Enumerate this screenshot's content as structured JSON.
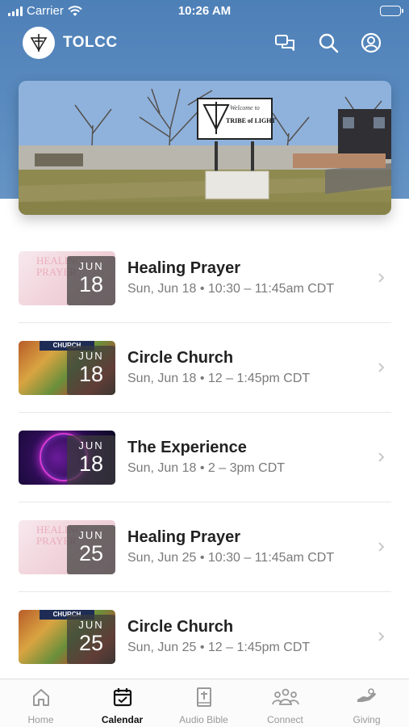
{
  "status_bar": {
    "carrier": "Carrier",
    "time": "10:26 AM"
  },
  "app": {
    "title": "TOLCC"
  },
  "header_icons": [
    "chat-bubbles-icon",
    "search-icon",
    "account-icon"
  ],
  "hero": {
    "sign_top": "Welcome to",
    "sign_main": "TRIBE of LIGHT"
  },
  "events": [
    {
      "title": "Healing Prayer",
      "month": "JUN",
      "day": "18",
      "subtitle": "Sun, Jun 18 • 10:30 – 11:45am CDT",
      "thumb_text": "HEALING PRAYER",
      "thumb_type": "healing"
    },
    {
      "title": "Circle Church",
      "month": "JUN",
      "day": "18",
      "subtitle": "Sun, Jun 18 • 12 – 1:45pm CDT",
      "thumb_text": "CHURCH",
      "thumb_type": "circle"
    },
    {
      "title": "The Experience",
      "month": "JUN",
      "day": "18",
      "subtitle": "Sun, Jun 18 • 2 – 3pm CDT",
      "thumb_text": "",
      "thumb_type": "experience"
    },
    {
      "title": "Healing Prayer",
      "month": "JUN",
      "day": "25",
      "subtitle": "Sun, Jun 25 • 10:30 – 11:45am CDT",
      "thumb_text": "HEALING PRAYER",
      "thumb_type": "healing"
    },
    {
      "title": "Circle Church",
      "month": "JUN",
      "day": "25",
      "subtitle": "Sun, Jun 25 • 12 – 1:45pm CDT",
      "thumb_text": "CHURCH",
      "thumb_type": "circle"
    }
  ],
  "tabs": [
    {
      "label": "Home",
      "icon": "home-icon",
      "active": false
    },
    {
      "label": "Calendar",
      "icon": "calendar-icon",
      "active": true
    },
    {
      "label": "Audio Bible",
      "icon": "bible-icon",
      "active": false
    },
    {
      "label": "Connect",
      "icon": "people-icon",
      "active": false
    },
    {
      "label": "Giving",
      "icon": "giving-hand-icon",
      "active": false
    }
  ],
  "colors": {
    "header": "#5585bd",
    "active_tab": "#111111",
    "inactive_tab": "#999999"
  }
}
